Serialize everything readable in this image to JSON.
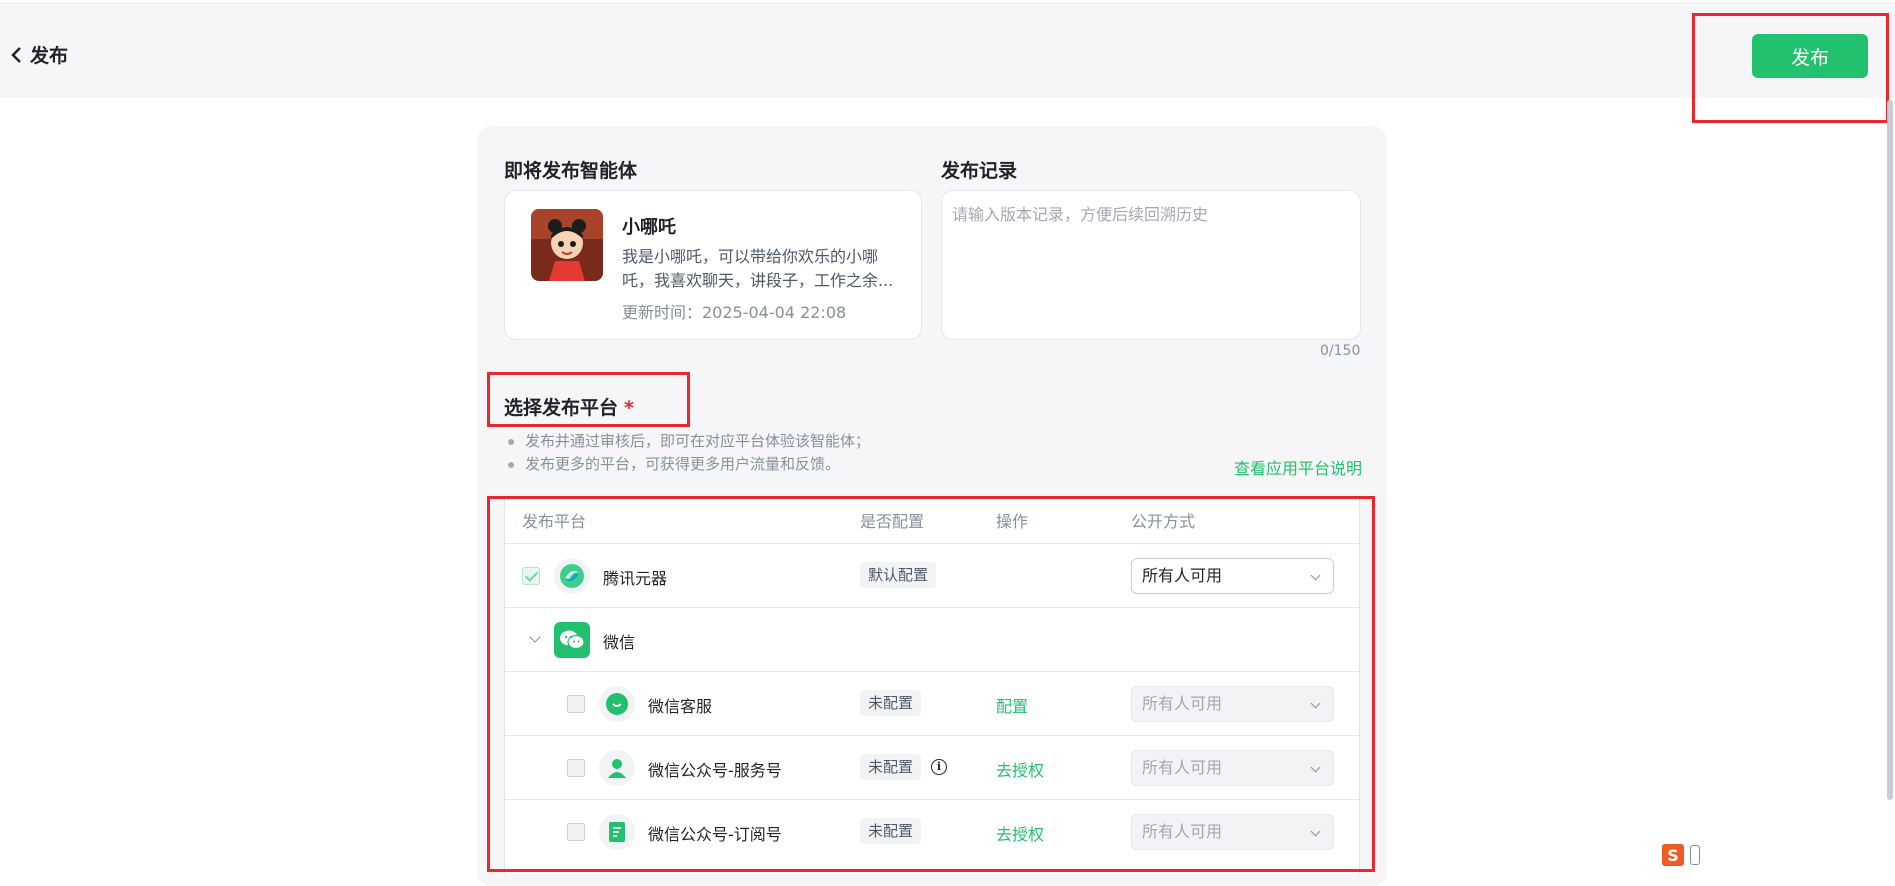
{
  "header": {
    "back_label": "发布",
    "publish_button": "发布"
  },
  "agent_section": {
    "title": "即将发布智能体",
    "name": "小哪吒",
    "description": "我是小哪吒，可以带给你欢乐的小哪吒，我喜欢聊天，讲段子，工作之余...",
    "updated": "更新时间：2025-04-04 22:08"
  },
  "record_section": {
    "title": "发布记录",
    "placeholder": "请输入版本记录，方便后续回溯历史",
    "counter": "0/150"
  },
  "platform_section": {
    "title": "选择发布平台",
    "required_mark": "*",
    "tips": [
      "发布并通过审核后，即可在对应平台体验该智能体；",
      "发布更多的平台，可获得更多用户流量和反馈。"
    ],
    "doc_link": "查看应用平台说明"
  },
  "table": {
    "headers": [
      "发布平台",
      "是否配置",
      "操作",
      "公开方式"
    ],
    "rows": [
      {
        "name": "腾讯元器",
        "status": "默认配置",
        "action": "",
        "visibility": "所有人可用",
        "checked": true,
        "disabled": false,
        "icon": "tencent-yuanqi-icon"
      },
      {
        "name": "微信",
        "group": true,
        "icon": "wechat-icon"
      },
      {
        "name": "微信客服",
        "status": "未配置",
        "action": "配置",
        "visibility": "所有人可用",
        "checked": false,
        "disabled": true,
        "icon": "wechat-service-icon"
      },
      {
        "name": "微信公众号-服务号",
        "status": "未配置",
        "action": "去授权",
        "visibility": "所有人可用",
        "checked": false,
        "disabled": true,
        "icon": "service-account-icon",
        "info": true
      },
      {
        "name": "微信公众号-订阅号",
        "status": "未配置",
        "action": "去授权",
        "visibility": "所有人可用",
        "checked": false,
        "disabled": true,
        "icon": "subscription-account-icon"
      }
    ]
  },
  "colors": {
    "accent": "#22c16f",
    "highlight": "#e8282b"
  }
}
